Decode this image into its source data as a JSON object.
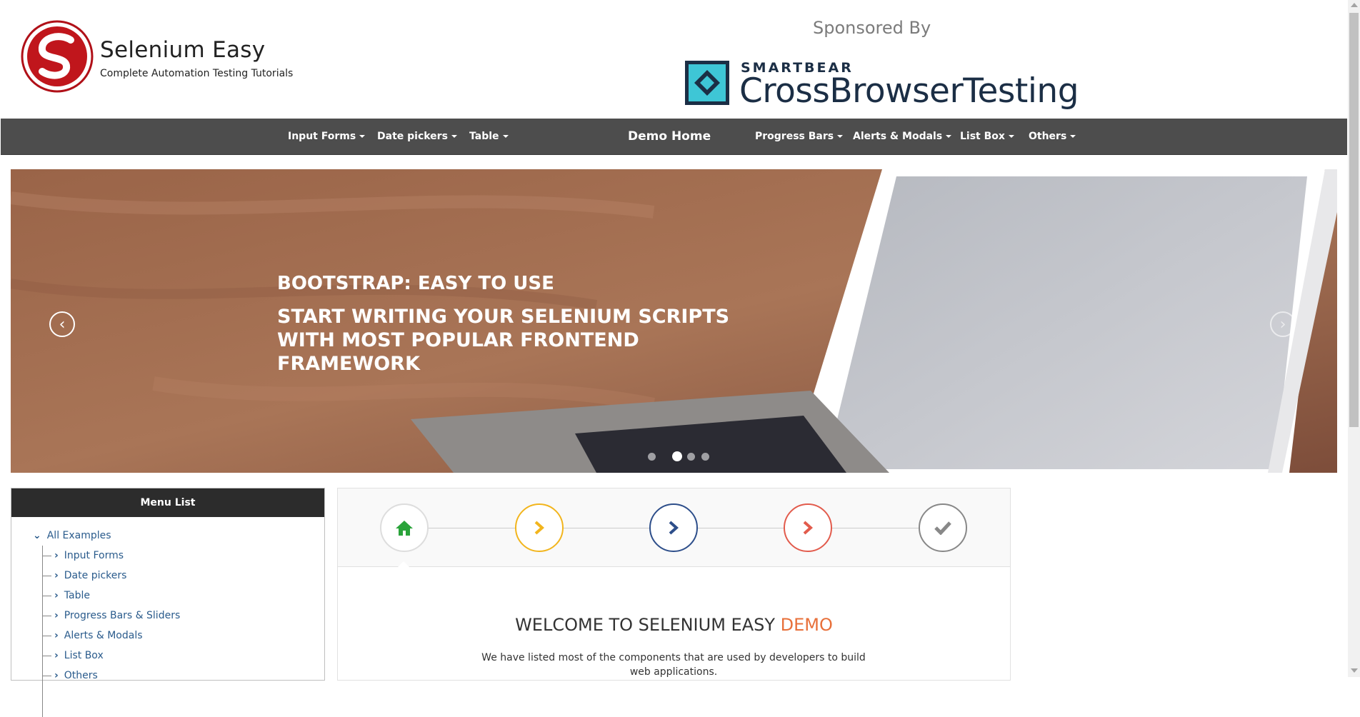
{
  "header": {
    "brand_title": "Selenium Easy",
    "brand_subtitle": "Complete Automation Testing Tutorials",
    "sponsored_by": "Sponsored By",
    "sponsor_small": "SMARTBEAR",
    "sponsor_large": "CrossBrowserTesting"
  },
  "nav": {
    "input_forms": "Input Forms",
    "date_pickers": "Date pickers",
    "table": "Table",
    "demo_home": "Demo Home",
    "progress_bars": "Progress Bars",
    "alerts_modals": "Alerts & Modals",
    "list_box": "List Box",
    "others": "Others"
  },
  "carousel": {
    "caption_title": "BOOTSTRAP: EASY TO USE",
    "caption_text": "START WRITING YOUR SELENIUM SCRIPTS WITH MOST POPULAR FRONTEND FRAMEWORK",
    "slide_count": 4,
    "active_slide": 2
  },
  "menu": {
    "heading": "Menu List",
    "root": "All Examples",
    "items": [
      "Input Forms",
      "Date pickers",
      "Table",
      "Progress Bars & Sliders",
      "Alerts & Modals",
      "List Box",
      "Others"
    ]
  },
  "wizard": {
    "steps": [
      {
        "icon": "home-icon",
        "color": "#2aa33a"
      },
      {
        "icon": "chevron-right-icon",
        "color": "#f2b51d"
      },
      {
        "icon": "chevron-right-icon",
        "color": "#2d4e8a"
      },
      {
        "icon": "chevron-right-icon",
        "color": "#e25b4c"
      },
      {
        "icon": "check-icon",
        "color": "#888888"
      }
    ],
    "welcome_prefix": "WELCOME TO SELENIUM EASY",
    "welcome_accent": "DEMO",
    "description": "We have listed most of the components that are used by developers to build web applications."
  },
  "colors": {
    "navbar": "#4d4d4d",
    "menu_header": "#2c2c2c",
    "link": "#2a5b8c",
    "accent": "#e8703a",
    "logo_red": "#c0161c"
  }
}
